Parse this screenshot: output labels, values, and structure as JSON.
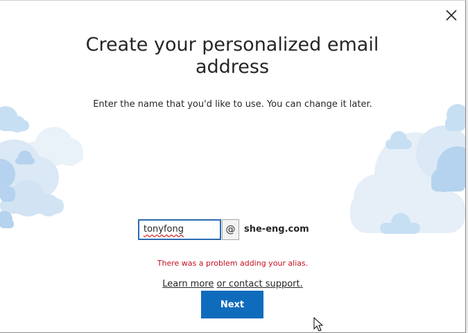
{
  "dialog": {
    "title": "Create your personalized email address",
    "subtitle": "Enter the name that you'd like to use. You can change it later.",
    "close_icon": "close-icon"
  },
  "alias": {
    "value": "tonyfong",
    "at_symbol": "@",
    "domain": "she-eng.com"
  },
  "error": {
    "message": "There was a problem adding your alias."
  },
  "support": {
    "learn_more": "Learn more",
    "separator": " ",
    "contact_support": "or contact support."
  },
  "actions": {
    "next_label": "Next"
  },
  "colors": {
    "accent": "#0f6cbd",
    "error": "#c50f1f",
    "cloud": "#c7dff3",
    "cloud_light": "#e4eef8"
  }
}
